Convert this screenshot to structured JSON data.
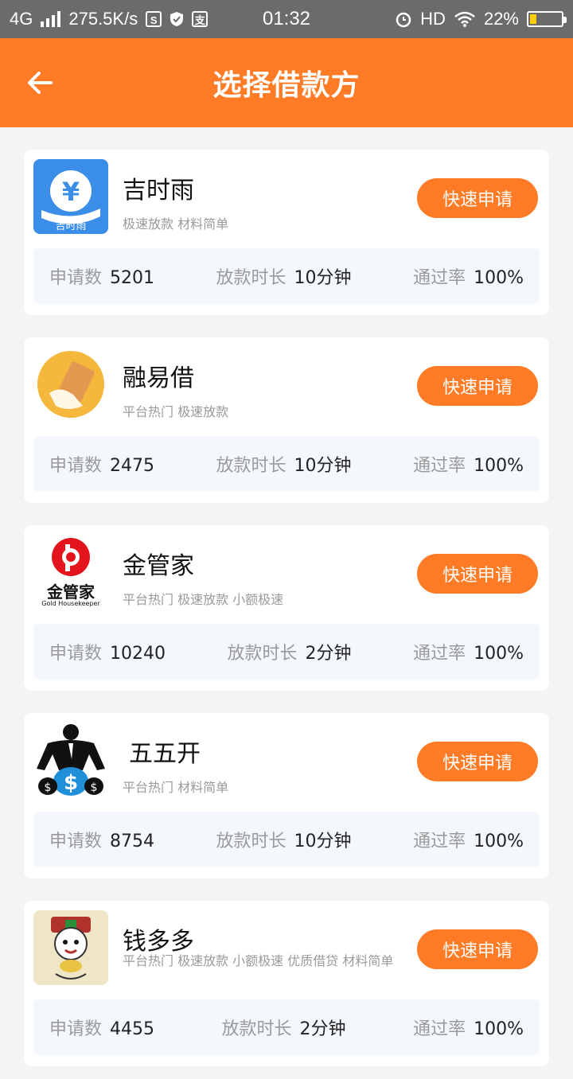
{
  "status_bar": {
    "network": "4G",
    "speed": "275.5K/s",
    "time": "01:32",
    "hd": "HD",
    "battery": "22%",
    "battery_level": 0.22
  },
  "header": {
    "title": "选择借款方"
  },
  "lenders": [
    {
      "name": "吉时雨",
      "tags": "极速放款 材料简单",
      "logo_text": "吉时雨",
      "button": "快速申请",
      "applications_label": "申请数",
      "applications": "5201",
      "duration_label": "放款时长",
      "duration": "10分钟",
      "pass_label": "通过率",
      "pass_rate": "100%"
    },
    {
      "name": "融易借",
      "tags": "平台热门 极速放款",
      "button": "快速申请",
      "applications_label": "申请数",
      "applications": "2475",
      "duration_label": "放款时长",
      "duration": "10分钟",
      "pass_label": "通过率",
      "pass_rate": "100%"
    },
    {
      "name": "金管家",
      "tags": "平台热门 极速放款 小额极速",
      "logo_text": "金管家",
      "logo_subtext": "Gold Housekeeper",
      "button": "快速申请",
      "applications_label": "申请数",
      "applications": "10240",
      "duration_label": "放款时长",
      "duration": "2分钟",
      "pass_label": "通过率",
      "pass_rate": "100%"
    },
    {
      "name": "五五开",
      "tags": "平台热门 材料简单",
      "button": "快速申请",
      "applications_label": "申请数",
      "applications": "8754",
      "duration_label": "放款时长",
      "duration": "10分钟",
      "pass_label": "通过率",
      "pass_rate": "100%"
    },
    {
      "name": "钱多多",
      "tags": "平台热门 极速放款 小额极速 优质借贷 材料简单",
      "button": "快速申请",
      "applications_label": "申请数",
      "applications": "4455",
      "duration_label": "放款时长",
      "duration": "2分钟",
      "pass_label": "通过率",
      "pass_rate": "100%"
    }
  ],
  "colors": {
    "accent": "#ff7b26",
    "status_bar": "#6b6b6b",
    "background": "#f4f4f4"
  }
}
